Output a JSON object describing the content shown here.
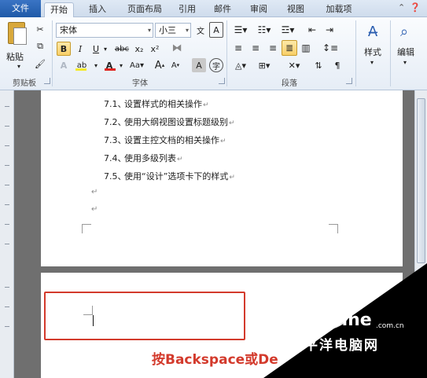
{
  "tabs": {
    "file": "文件",
    "items": [
      "开始",
      "插入",
      "页面布局",
      "引用",
      "邮件",
      "审阅",
      "视图",
      "加载项"
    ],
    "active_index": 0
  },
  "ribbon": {
    "clipboard": {
      "paste": "粘贴",
      "label": "剪贴板"
    },
    "font": {
      "name": "宋体",
      "size": "小三",
      "bold": "B",
      "italic": "I",
      "underline": "U",
      "strike": "abc",
      "subscript": "x₂",
      "superscript": "x²",
      "grow": "A",
      "shrink": "A",
      "case": "Aa",
      "clear": "A",
      "phonetic": "文",
      "border": "A",
      "enclose": "字",
      "label": "字体"
    },
    "paragraph": {
      "label": "段落"
    },
    "styles": {
      "label": "样式"
    },
    "editing": {
      "label": "编辑"
    }
  },
  "document": {
    "toc": [
      {
        "num": "7.1、",
        "text": "设置样式的相关操作"
      },
      {
        "num": "7.2、",
        "text": "使用大纲视图设置标题级别"
      },
      {
        "num": "7.3、",
        "text": "设置主控文档的相关操作"
      },
      {
        "num": "7.4、",
        "text": "使用多级列表"
      },
      {
        "num": "7.5、",
        "text": "使用“设计”选项卡下的样式"
      }
    ],
    "paragraph_mark": "↵",
    "caption": "按Backspace或De"
  },
  "watermark": {
    "logo": "PConline",
    "domain": ".com.cn",
    "cn": "太平洋电脑网"
  },
  "colors": {
    "accent": "#d33a2c",
    "file_tab": "#2a64b4"
  }
}
